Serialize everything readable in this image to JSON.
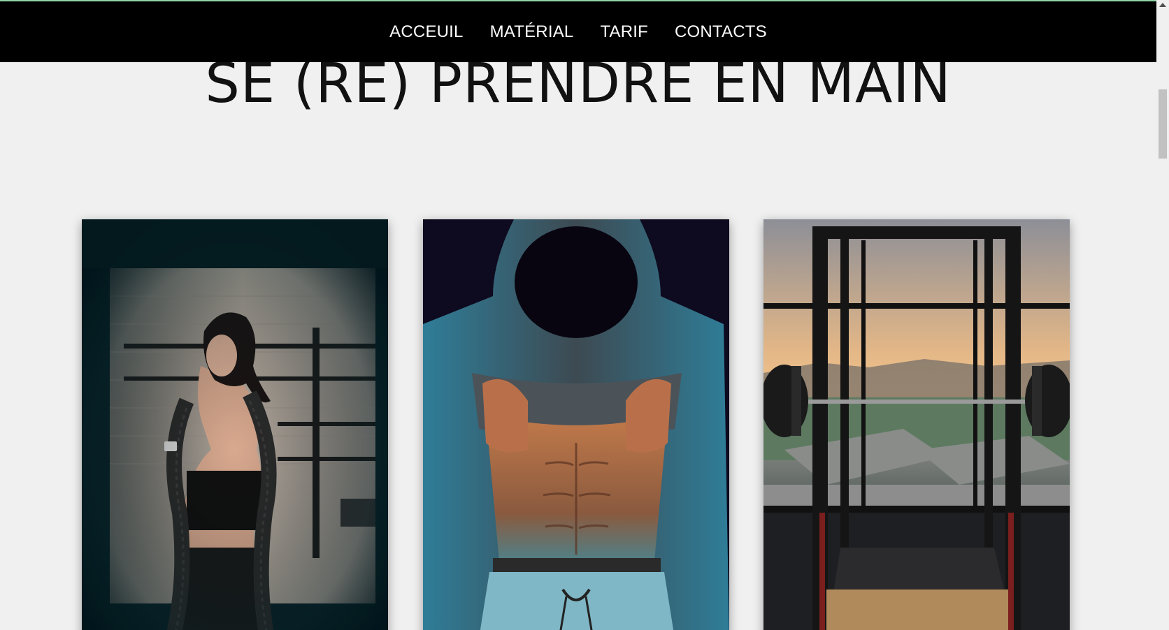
{
  "nav": {
    "items": [
      {
        "label": "ACCEUIL"
      },
      {
        "label": "MATÉRIAL"
      },
      {
        "label": "TARIF"
      },
      {
        "label": "CONTACTS"
      }
    ]
  },
  "hero": {
    "title": "SE (RE) PRENDRE EN MAIN"
  },
  "gallery": {
    "cards": [
      {
        "image": "woman-with-battle-rope-photo"
      },
      {
        "image": "man-in-hoodie-showing-abs-photo"
      },
      {
        "image": "squat-rack-sunset-window-photo"
      }
    ]
  },
  "colors": {
    "navbar_bg": "#000000",
    "nav_text": "#ffffff",
    "page_bg": "#f0f0f0",
    "title_text": "#111111"
  }
}
